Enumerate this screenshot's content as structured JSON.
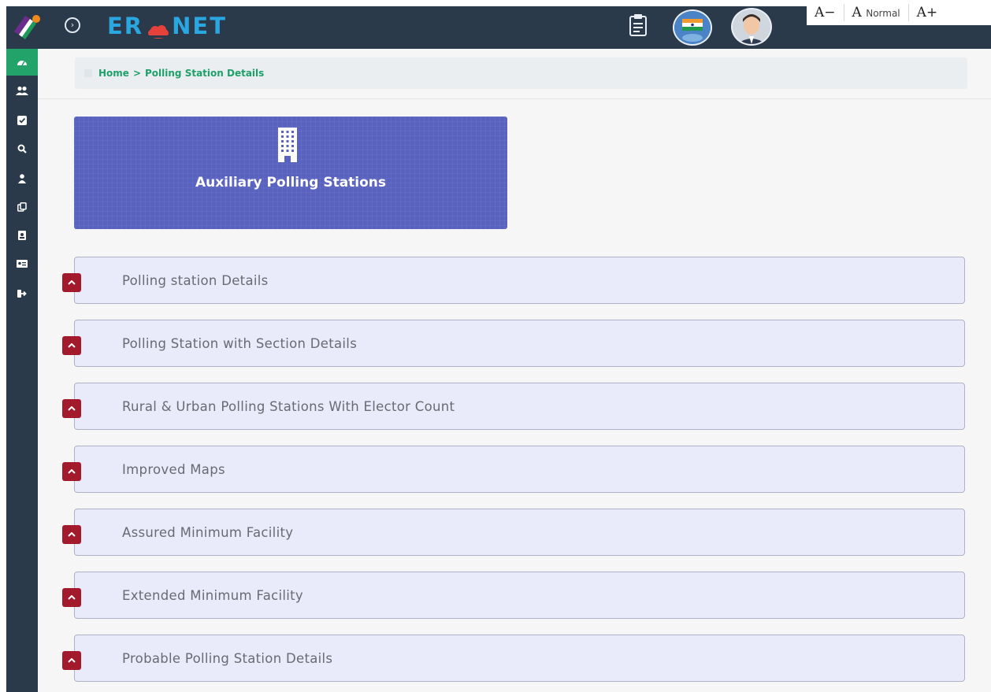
{
  "header": {
    "brand_left": "ER",
    "brand_right": "NET",
    "brand_accent": "#2aa6e0",
    "font_tools": {
      "decrease": "A−",
      "normal_prefix": "A",
      "normal_label": "Normal",
      "increase": "A+"
    }
  },
  "sidebar": {
    "items": [
      {
        "icon": "dashboard-icon",
        "active": true
      },
      {
        "icon": "users-icon"
      },
      {
        "icon": "check-square-icon"
      },
      {
        "icon": "search-icon"
      },
      {
        "icon": "user-icon"
      },
      {
        "icon": "copy-icon"
      },
      {
        "icon": "id-badge-icon"
      },
      {
        "icon": "id-card-icon"
      },
      {
        "icon": "sign-out-icon"
      }
    ]
  },
  "breadcrumb": {
    "home": "Home",
    "separator": ">",
    "current": "Polling Station Details"
  },
  "tile": {
    "label": "Auxiliary Polling Stations",
    "icon": "building-icon"
  },
  "panels": [
    {
      "title": "Polling station Details"
    },
    {
      "title": "Polling Station with Section Details"
    },
    {
      "title": "Rural & Urban Polling Stations With Elector Count"
    },
    {
      "title": "Improved Maps"
    },
    {
      "title": "Assured Minimum Facility"
    },
    {
      "title": "Extended Minimum Facility"
    },
    {
      "title": "Probable Polling Station Details"
    }
  ],
  "colors": {
    "header_bg": "#2b3a4a",
    "sidebar_active": "#22a36a",
    "tile_bg": "#5962bf",
    "panel_bg": "#e9ebfb",
    "chevron_bg": "#a31a2c",
    "breadcrumb_text": "#1fa06a"
  }
}
